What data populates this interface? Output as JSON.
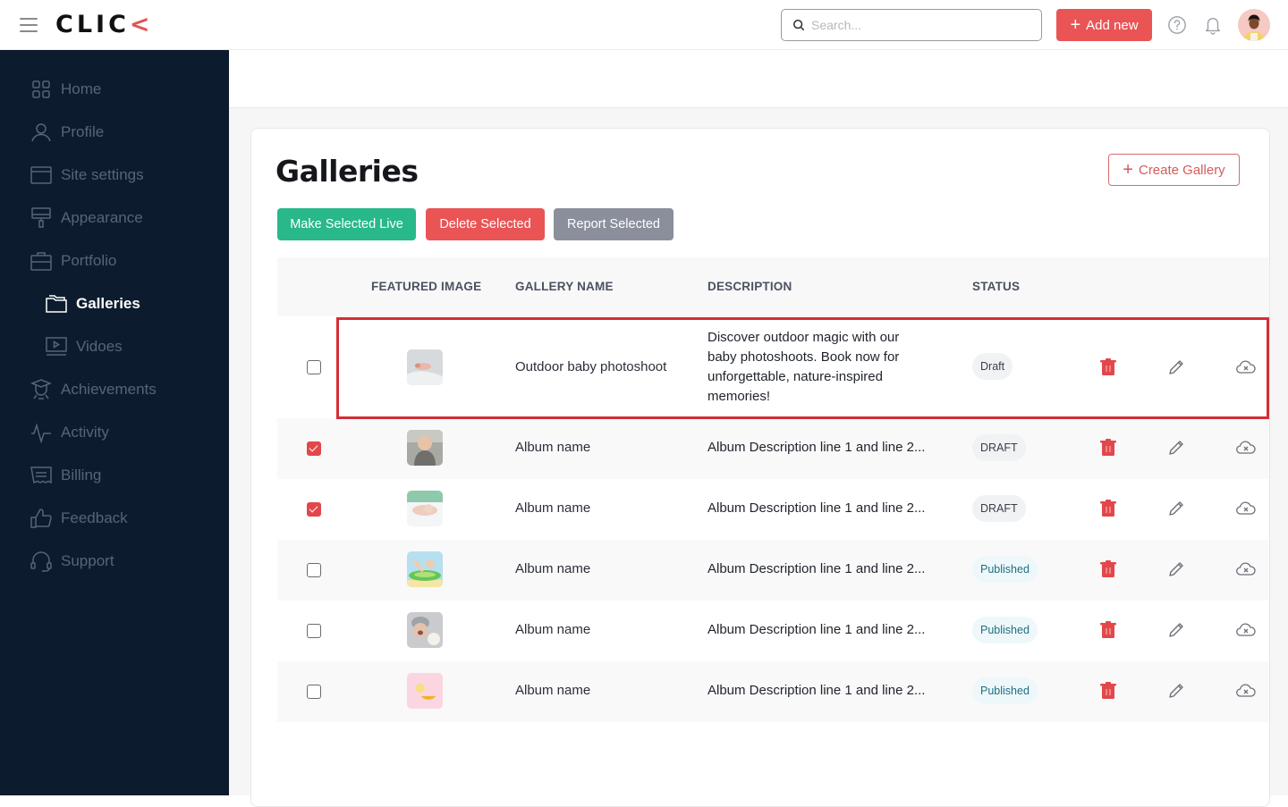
{
  "app": {
    "logo_text": "CLIC",
    "logo_accent": "<",
    "accent_color": "#ea5455",
    "sidebar_color": "#0d1b2e"
  },
  "header": {
    "search_placeholder": "Search...",
    "add_new_label": "Add new",
    "icons": [
      "menu-icon",
      "search-icon",
      "plus-icon",
      "help-icon",
      "bell-icon",
      "avatar"
    ]
  },
  "sidebar": {
    "items": [
      {
        "label": "Home",
        "icon": "grid-icon"
      },
      {
        "label": "Profile",
        "icon": "user-icon"
      },
      {
        "label": "Site settings",
        "icon": "window-icon"
      },
      {
        "label": "Appearance",
        "icon": "paint-roller-icon"
      },
      {
        "label": "Portfolio",
        "icon": "briefcase-icon"
      },
      {
        "label": "Galleries",
        "icon": "folder-icon",
        "active": true,
        "sub": true
      },
      {
        "label": "Vidoes",
        "icon": "video-icon",
        "sub": true
      },
      {
        "label": "Achievements",
        "icon": "graduate-icon"
      },
      {
        "label": "Activity",
        "icon": "activity-icon"
      },
      {
        "label": "Billing",
        "icon": "receipt-icon"
      },
      {
        "label": "Feedback",
        "icon": "thumbs-up-icon"
      },
      {
        "label": "Support",
        "icon": "headset-icon"
      }
    ]
  },
  "page": {
    "title": "Galleries",
    "create_label": "Create Gallery",
    "bulk_actions": {
      "live": "Make Selected Live",
      "delete": "Delete Selected",
      "report": "Report Selected"
    }
  },
  "table": {
    "columns": [
      "FEATURED IMAGE",
      "GALLERY NAME",
      "DESCRIPTION",
      "STATUS"
    ],
    "rows": [
      {
        "checked": false,
        "name": "Outdoor baby photoshoot",
        "description": "Discover outdoor magic with our baby photoshoots. Book now for unforgettable, nature-inspired memories!",
        "status": "Draft",
        "status_type": "draft",
        "highlighted": true
      },
      {
        "checked": true,
        "name": "Album name",
        "description": "Album Description line 1 and line 2...",
        "status": "DRAFT",
        "status_type": "draft"
      },
      {
        "checked": true,
        "name": "Album name",
        "description": "Album Description line 1 and line 2...",
        "status": "DRAFT",
        "status_type": "draft"
      },
      {
        "checked": false,
        "name": "Album name",
        "description": "Album Description line 1 and line 2...",
        "status": "Published",
        "status_type": "published"
      },
      {
        "checked": false,
        "name": "Album name",
        "description": "Album Description line 1 and line 2...",
        "status": "Published",
        "status_type": "published"
      },
      {
        "checked": false,
        "name": "Album name",
        "description": "Album Description line 1 and line 2...",
        "status": "Published",
        "status_type": "published"
      }
    ]
  }
}
